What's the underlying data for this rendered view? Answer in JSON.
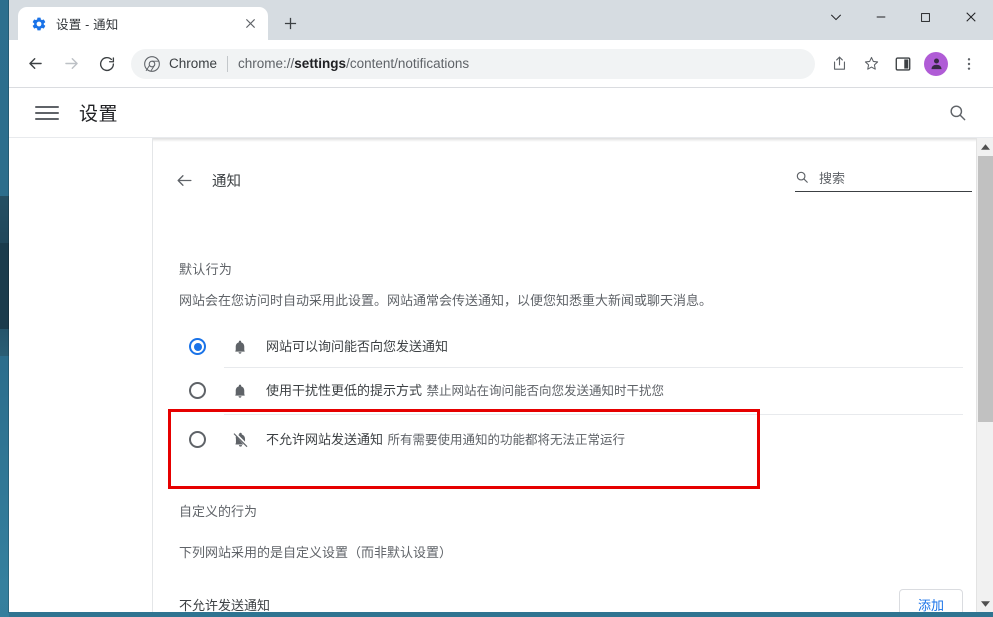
{
  "browser": {
    "tab": {
      "title": "设置 - 通知",
      "favicon": "gear-icon",
      "close_label": "×"
    },
    "new_tab_label": "+",
    "window_controls": {
      "tab_search": "⌄",
      "minimize": "—",
      "maximize": "□",
      "close": "✕"
    },
    "omnibox": {
      "scheme_label": "Chrome",
      "url_prefix": "chrome://",
      "url_bold": "settings",
      "url_suffix": "/content/notifications",
      "full_url": "chrome://settings/content/notifications"
    },
    "toolbar_icons": [
      "share-icon",
      "bookmark-star-icon",
      "side-panel-icon",
      "profile-avatar",
      "more-menu-icon"
    ],
    "nav": {
      "back": "back-arrow-icon",
      "forward": "forward-arrow-icon",
      "reload": "reload-icon"
    },
    "avatar_color": "#b05cd6"
  },
  "settings": {
    "menu_label": "menu-icon",
    "title": "设置",
    "search_icon": "search-icon"
  },
  "page": {
    "back_label": "back-arrow-icon",
    "subtitle": "通知",
    "search": {
      "placeholder": "搜索",
      "icon": "search-icon"
    },
    "default_behavior": {
      "title": "默认行为",
      "description": "网站会在您访问时自动采用此设置。网站通常会传送通知，以便您知悉重大新闻或聊天消息。",
      "options": [
        {
          "id": "sites-can-ask",
          "icon": "bell-icon",
          "label": "网站可以询问能否向您发送通知",
          "sublabel": "",
          "selected": true,
          "highlighted": false
        },
        {
          "id": "use-quieter-messaging",
          "icon": "bell-icon",
          "label": "使用干扰性更低的提示方式",
          "sublabel": "禁止网站在询问能否向您发送通知时干扰您",
          "selected": false,
          "highlighted": false
        },
        {
          "id": "dont-allow-notifications",
          "icon": "bell-off-icon",
          "label": "不允许网站发送通知",
          "sublabel": "所有需要使用通知的功能都将无法正常运行",
          "selected": false,
          "highlighted": true
        }
      ]
    },
    "custom_behavior": {
      "title": "自定义的行为",
      "description": "下列网站采用的是自定义设置（而非默认设置）",
      "not_allowed_label": "不允许发送通知",
      "add_button": "添加"
    },
    "highlight_color": "#e60000",
    "accent_color": "#1a73e8"
  }
}
